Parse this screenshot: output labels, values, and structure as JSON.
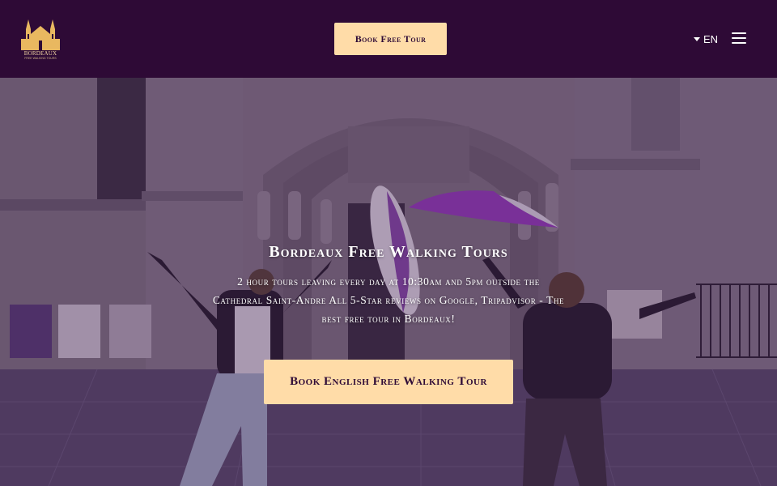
{
  "header": {
    "logo_text": "BORDEAUX",
    "logo_sub": "FREE WALKING TOURS",
    "cta_label": "Book Free Tour",
    "language": "EN"
  },
  "hero": {
    "title": "Bordeaux Free Walking Tours",
    "subtitle": "2 hour tours leaving every day at 10:30am and 5pm outside the Cathedral Saint-Andre All 5-Star reviews on Google, Tripadvisor - The best free tour in Bordeaux!",
    "cta_label": "Book English Free Walking Tour"
  },
  "colors": {
    "brand_purple": "#2e0a36",
    "accent_peach": "#ffdca8"
  },
  "icons": {
    "logo": "cathedral-logo-icon",
    "language_caret": "caret-down-icon",
    "menu": "hamburger-menu-icon"
  }
}
